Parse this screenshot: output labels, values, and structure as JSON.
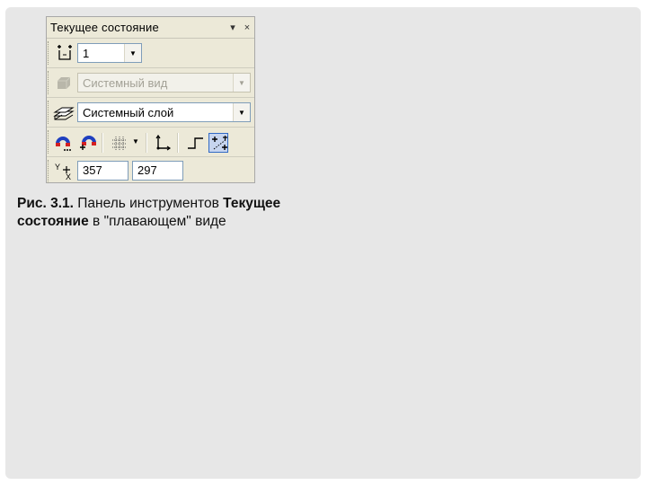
{
  "panel": {
    "title": "Текущее состояние",
    "title_controls": [
      "▾",
      "×"
    ],
    "step_combo": {
      "value": "1"
    },
    "view_combo": {
      "value": "Системный вид"
    },
    "layer_combo": {
      "value": "Системный слой"
    },
    "coord_x": "357",
    "coord_y": "297",
    "icons": [
      "cursor-step-icon",
      "view-icon",
      "layer-icon",
      "snap-magnet-icon",
      "local-snap-magnet-icon",
      "grid-icon",
      "local-cs-icon",
      "ortho-icon",
      "rounding-icon",
      "coordinates-icon"
    ]
  },
  "caption": {
    "fig_label": "Рис. 3.1.",
    "text1": " Панель инструментов ",
    "bold_name": "Текущее состояние",
    "text2": " в \"плавающем\" виде"
  }
}
